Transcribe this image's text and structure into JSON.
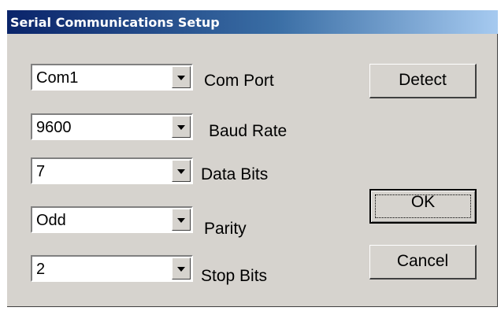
{
  "window": {
    "title": "Serial Communications Setup"
  },
  "fields": [
    {
      "value": "Com1",
      "label": "Com Port"
    },
    {
      "value": "9600",
      "label": "Baud Rate"
    },
    {
      "value": "7",
      "label": "Data Bits"
    },
    {
      "value": "Odd",
      "label": "Parity"
    },
    {
      "value": "2",
      "label": "Stop Bits"
    }
  ],
  "buttons": {
    "detect": "Detect",
    "ok": "OK",
    "cancel": "Cancel"
  }
}
